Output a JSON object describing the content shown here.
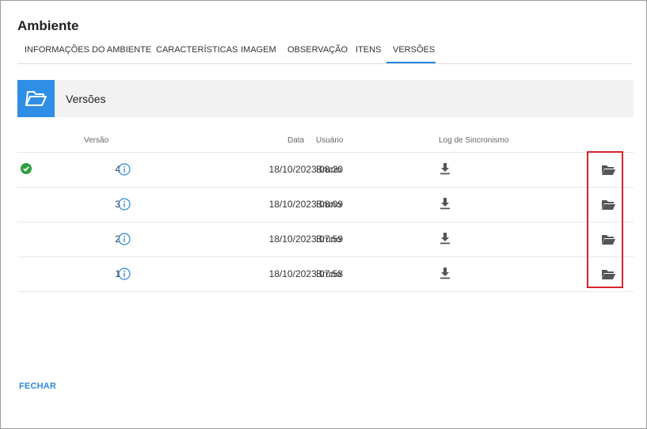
{
  "dialog": {
    "title": "Ambiente"
  },
  "tabs": [
    {
      "label": "INFORMAÇÕES DO AMBIENTE",
      "active": false
    },
    {
      "label": "CARACTERÍSTICAS",
      "active": false
    },
    {
      "label": "IMAGEM",
      "active": false
    },
    {
      "label": "OBSERVAÇÃO",
      "active": false
    },
    {
      "label": "ITENS",
      "active": false
    },
    {
      "label": "VERSÕES",
      "active": true
    }
  ],
  "section": {
    "title": "Versões",
    "icon": "folder-open-icon"
  },
  "table": {
    "columns": {
      "version": "Versão",
      "date": "Data",
      "user": "Usuário",
      "sync_log": "Log de Sincronismo"
    },
    "rows": [
      {
        "version": "4",
        "date": "18/10/2023 08:20",
        "user": "Bruno",
        "current": true
      },
      {
        "version": "3",
        "date": "18/10/2023 08:09",
        "user": "Bruno",
        "current": false
      },
      {
        "version": "2",
        "date": "18/10/2023 07:59",
        "user": "Bruno",
        "current": false
      },
      {
        "version": "1",
        "date": "18/10/2023 07:58",
        "user": "Bruno",
        "current": false
      }
    ]
  },
  "footer": {
    "close_label": "FECHAR"
  },
  "colors": {
    "accent": "#2e86de",
    "success": "#2e9e3e",
    "highlight": "#d9232d",
    "icon_gray": "#555555"
  }
}
